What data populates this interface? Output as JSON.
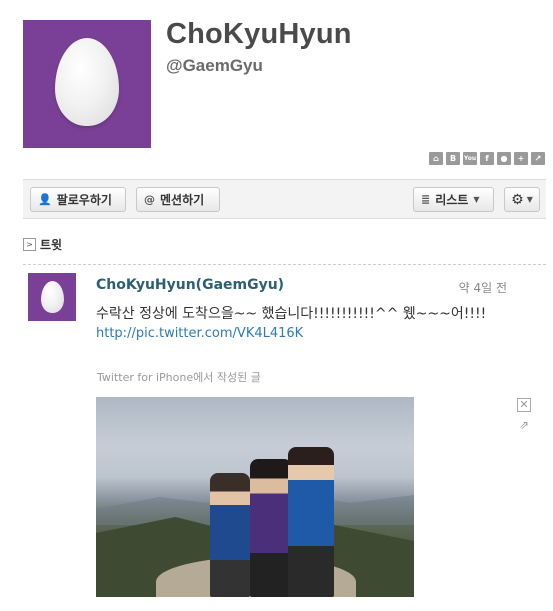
{
  "profile": {
    "display_name": "ChoKyuHyun",
    "screen_name": "@GaemGyu",
    "avatar_color": "#7a3f96",
    "avatar_icon": "egg-avatar"
  },
  "social_icons": [
    "home-icon",
    "blog-icon",
    "youtube-icon",
    "facebook-icon",
    "chat-icon",
    "plus-icon",
    "external-icon"
  ],
  "social_icon_glyphs": [
    "⌂",
    "B",
    "You",
    "f",
    "●",
    "+",
    "↗"
  ],
  "actions": {
    "follow_label": "팔로우하기",
    "mention_label": "멘션하기",
    "list_label": "리스트",
    "follow_icon": "👤",
    "mention_icon": "@",
    "list_icon": "≣",
    "gear_icon": "⚙",
    "caret": "▼"
  },
  "tweets_heading": {
    "label": "트윗",
    "arrow": ">"
  },
  "tweet": {
    "author": "ChoKyuHyun(GaemGyu)",
    "time": "약 4일 전",
    "text": "수락산 정상에 도착으을~~ 했습니다!!!!!!!!!!!^^ 웼~~~어!!!!",
    "link": "http://pic.twitter.com/VK4L416K",
    "source": "Twitter for iPhone에서 작성된 글",
    "close_glyph": "✕",
    "share_glyph": "⇗"
  }
}
